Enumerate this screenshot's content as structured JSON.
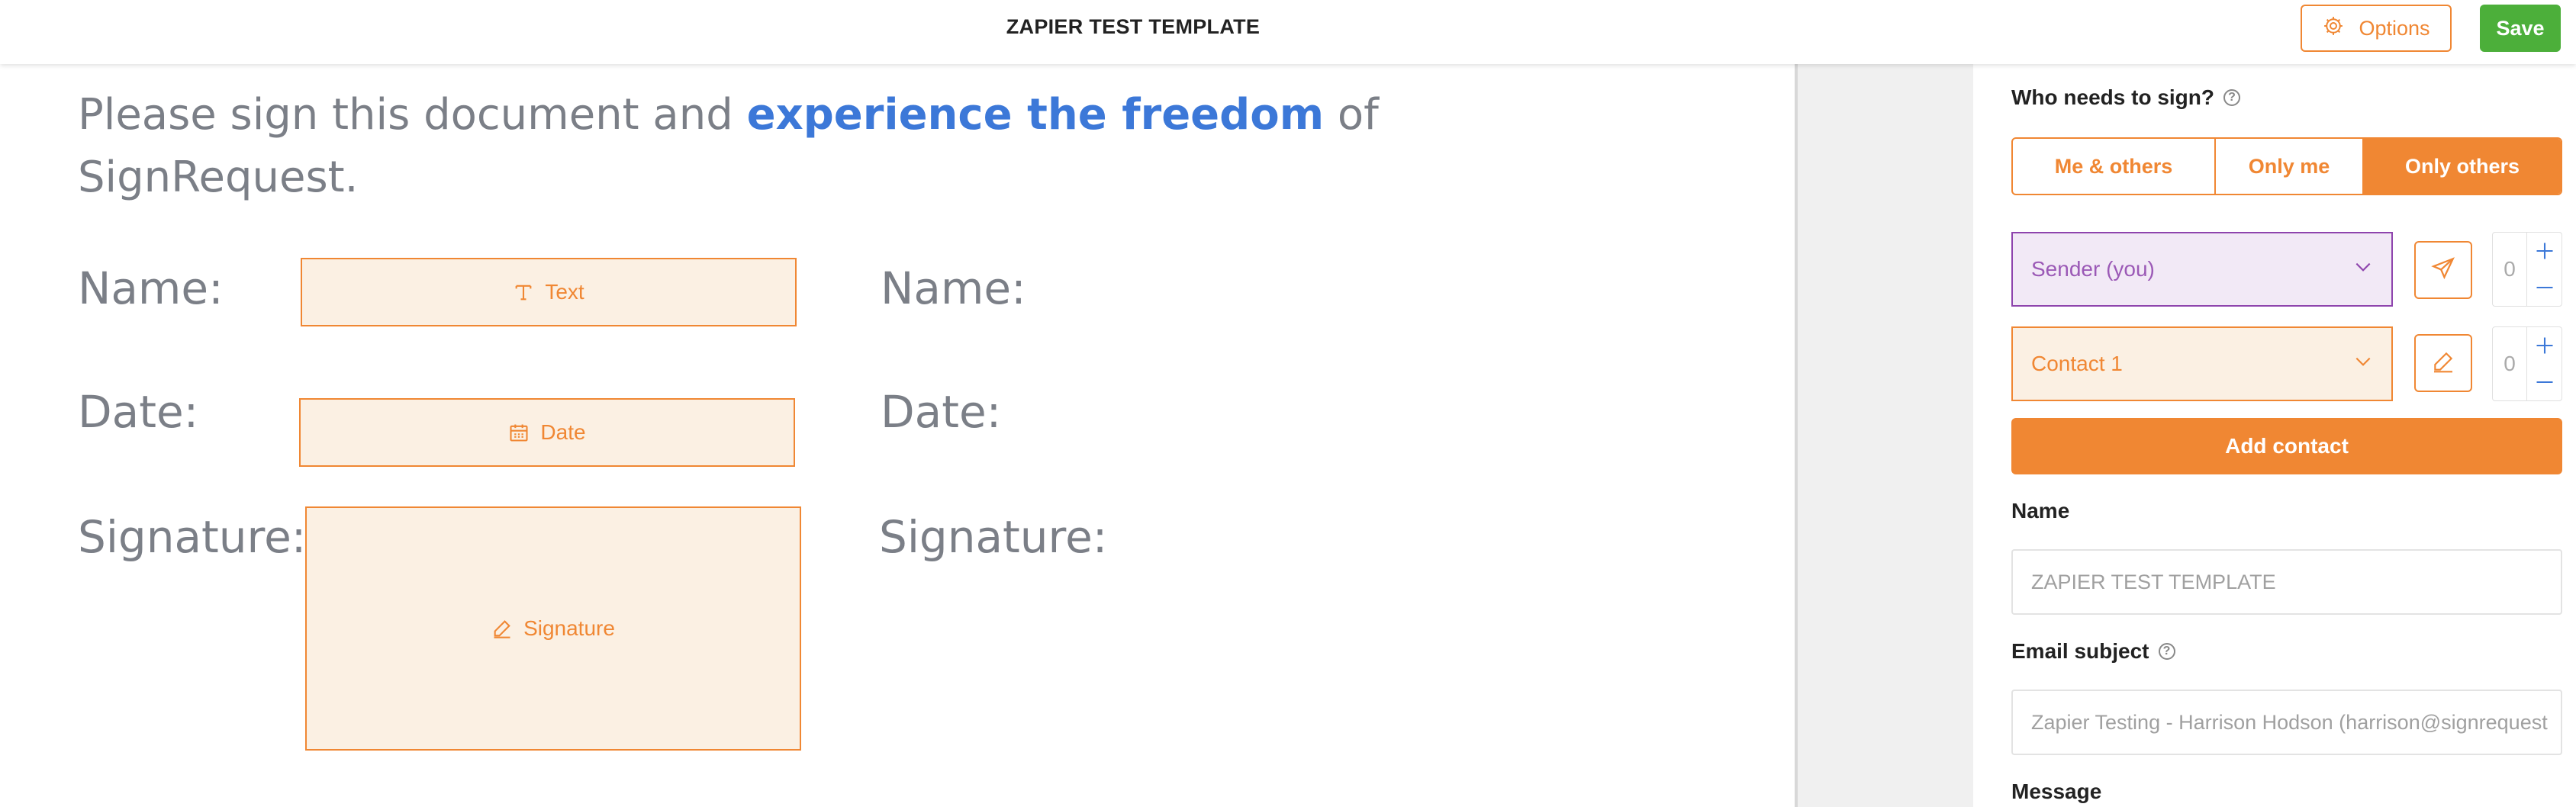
{
  "header": {
    "title": "ZAPIER TEST TEMPLATE",
    "options_label": "Options",
    "save_label": "Save"
  },
  "document": {
    "headline_pre": "Please sign this document and ",
    "headline_accent": "experience the freedom",
    "headline_post": " of SignRequest.",
    "left_labels": {
      "name": "Name:",
      "date": "Date:",
      "signature": "Signature:"
    },
    "right_labels": {
      "name": "Name:",
      "date": "Date:",
      "signature": "Signature:"
    },
    "fields": {
      "text": "Text",
      "date": "Date",
      "signature": "Signature"
    }
  },
  "panel": {
    "who_label": "Who needs to sign?",
    "signer_options": [
      "Me & others",
      "Only me",
      "Only others"
    ],
    "selected_option": "Only others",
    "signers": [
      {
        "label": "Sender (you)",
        "count": "0"
      },
      {
        "label": "Contact 1",
        "count": "0"
      }
    ],
    "add_contact_label": "Add contact",
    "name_label": "Name",
    "name_value": "ZAPIER TEST TEMPLATE",
    "email_subject_label": "Email subject",
    "email_subject_value": "Zapier Testing - Harrison Hodson (harrison@signrequest",
    "message_label": "Message"
  },
  "colors": {
    "accent": "#f08733",
    "save_green": "#4caf3a",
    "link_blue": "#3c78d8",
    "sender_purple": "#8e44ad"
  },
  "icons": [
    "gear-icon",
    "text-icon",
    "calendar-icon",
    "pen-icon",
    "send-icon",
    "help-icon",
    "chevron-down-icon",
    "plus-icon",
    "minus-icon"
  ]
}
